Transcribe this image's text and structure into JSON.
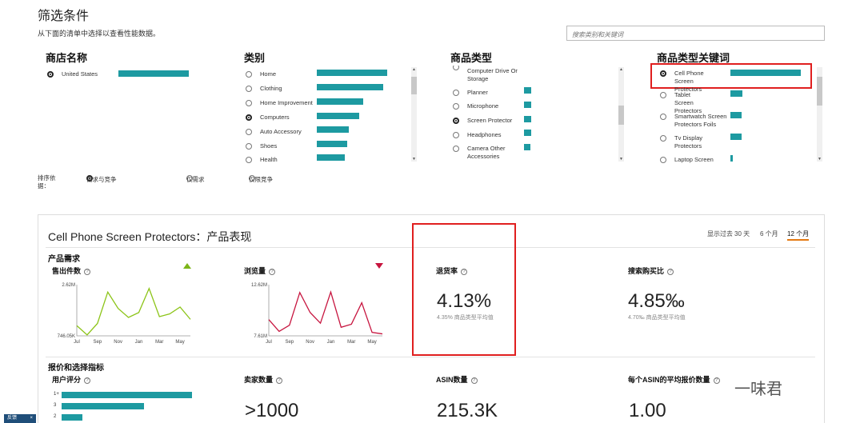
{
  "header": {
    "title": "筛选条件",
    "instruction": "从下面的清单中选择以查看性能数据。",
    "search_placeholder": "搜索类别和关键词"
  },
  "filters": {
    "store": {
      "title": "商店名称",
      "items": [
        {
          "label": "United States",
          "selected": true,
          "bar": 1.0
        }
      ]
    },
    "category": {
      "title": "类别",
      "items": [
        {
          "label": "Home",
          "selected": false,
          "bar": 1.0
        },
        {
          "label": "Clothing",
          "selected": false,
          "bar": 0.94
        },
        {
          "label": "Home Improvement",
          "selected": false,
          "bar": 0.66
        },
        {
          "label": "Computers",
          "selected": true,
          "bar": 0.6
        },
        {
          "label": "Auto Accessory",
          "selected": false,
          "bar": 0.45
        },
        {
          "label": "Shoes",
          "selected": false,
          "bar": 0.43
        },
        {
          "label": "Health",
          "selected": false,
          "bar": 0.4
        }
      ]
    },
    "product_type": {
      "title": "商品类型",
      "items": [
        {
          "label": "Computer Drive Or Storage",
          "selected": false,
          "bar": 0.0
        },
        {
          "label": "Planner",
          "selected": false,
          "bar": 0.1
        },
        {
          "label": "Microphone",
          "selected": false,
          "bar": 0.1
        },
        {
          "label": "Screen Protector",
          "selected": true,
          "bar": 0.1
        },
        {
          "label": "Headphones",
          "selected": false,
          "bar": 0.1
        },
        {
          "label": "Camera Other Accessories",
          "selected": false,
          "bar": 0.08
        }
      ]
    },
    "keyword": {
      "title": "商品类型关键词",
      "items": [
        {
          "label": "Cell Phone Screen Protectors",
          "selected": true,
          "bar": 1.0
        },
        {
          "label": "Tablet Screen Protectors",
          "selected": false,
          "bar": 0.17
        },
        {
          "label": "Smartwatch Screen Protectors Foils",
          "selected": false,
          "bar": 0.16
        },
        {
          "label": "Tv Display Protectors",
          "selected": false,
          "bar": 0.16
        },
        {
          "label": "Laptop Screen",
          "selected": false,
          "bar": 0.03
        }
      ]
    }
  },
  "sort": {
    "label": "排序依据：",
    "options": [
      {
        "label": "需求与竞争",
        "selected": true
      },
      {
        "label": "仅需求",
        "selected": false
      },
      {
        "label": "仅限竞争",
        "selected": false
      }
    ]
  },
  "performance": {
    "title": "Cell Phone Screen Protectors：产品表现",
    "period_label": "显示过去",
    "periods": [
      {
        "label": "30 天",
        "active": false
      },
      {
        "label": "6 个月",
        "active": false
      },
      {
        "label": "12 个月",
        "active": true
      }
    ],
    "demand_section": "产品需求",
    "units_sold": {
      "title": "售出件数",
      "trend": "up",
      "trend_color": "#7cb518",
      "line_color": "#8cc418"
    },
    "page_views": {
      "title": "浏览量",
      "trend": "down",
      "trend_color": "#c7153f",
      "line_color": "#c7153f"
    },
    "return_rate": {
      "title": "退货率",
      "value": "4.13%",
      "note": "4.35% 商品类型平均值"
    },
    "search_conversion": {
      "title": "搜索购买比",
      "value": "4.85‰",
      "note": "4.70‰ 商品类型平均值"
    },
    "pricing_section": "报价和选择指标",
    "ratings": {
      "title": "用户评分",
      "rows": [
        {
          "label": "1+",
          "value": 1.0
        },
        {
          "label": "3",
          "value": 0.62
        },
        {
          "label": "2",
          "value": 0.16
        }
      ]
    },
    "sellers": {
      "title": "卖家数量",
      "value": ">1000"
    },
    "asin_count": {
      "title": "ASIN数量",
      "value": "215.3K"
    },
    "offers_per_asin": {
      "title": "每个ASIN的平均报价数量",
      "value": "1.00"
    }
  },
  "chart_data": [
    {
      "type": "line",
      "x": [
        "Jul",
        "Aug",
        "Sep",
        "Oct",
        "Nov",
        "Dec",
        "Jan",
        "Feb",
        "Mar",
        "Apr",
        "May",
        "Jun"
      ],
      "xticks": [
        "Jul",
        "Sep",
        "Nov",
        "Jan",
        "Mar",
        "May"
      ],
      "yticks": [
        "2.62M",
        "746.05K"
      ],
      "ylim": [
        746050,
        2620000
      ],
      "values": [
        1120000,
        780000,
        1200000,
        2350000,
        1750000,
        1420000,
        1600000,
        2480000,
        1450000,
        1550000,
        1800000,
        1350000
      ]
    },
    {
      "type": "line",
      "x": [
        "Jul",
        "Aug",
        "Sep",
        "Oct",
        "Nov",
        "Dec",
        "Jan",
        "Feb",
        "Mar",
        "Apr",
        "May",
        "Jun"
      ],
      "xticks": [
        "Jul",
        "Sep",
        "Nov",
        "Jan",
        "Mar",
        "May"
      ],
      "yticks": [
        "12.62M",
        "7.61M"
      ],
      "ylim": [
        7610000,
        12620000
      ],
      "values": [
        9200000,
        8050000,
        8650000,
        11850000,
        9900000,
        8850000,
        11900000,
        8450000,
        8750000,
        10850000,
        7950000,
        7800000
      ]
    }
  ],
  "feedback": {
    "label": "反馈",
    "close": "×"
  },
  "watermark": "一味君"
}
